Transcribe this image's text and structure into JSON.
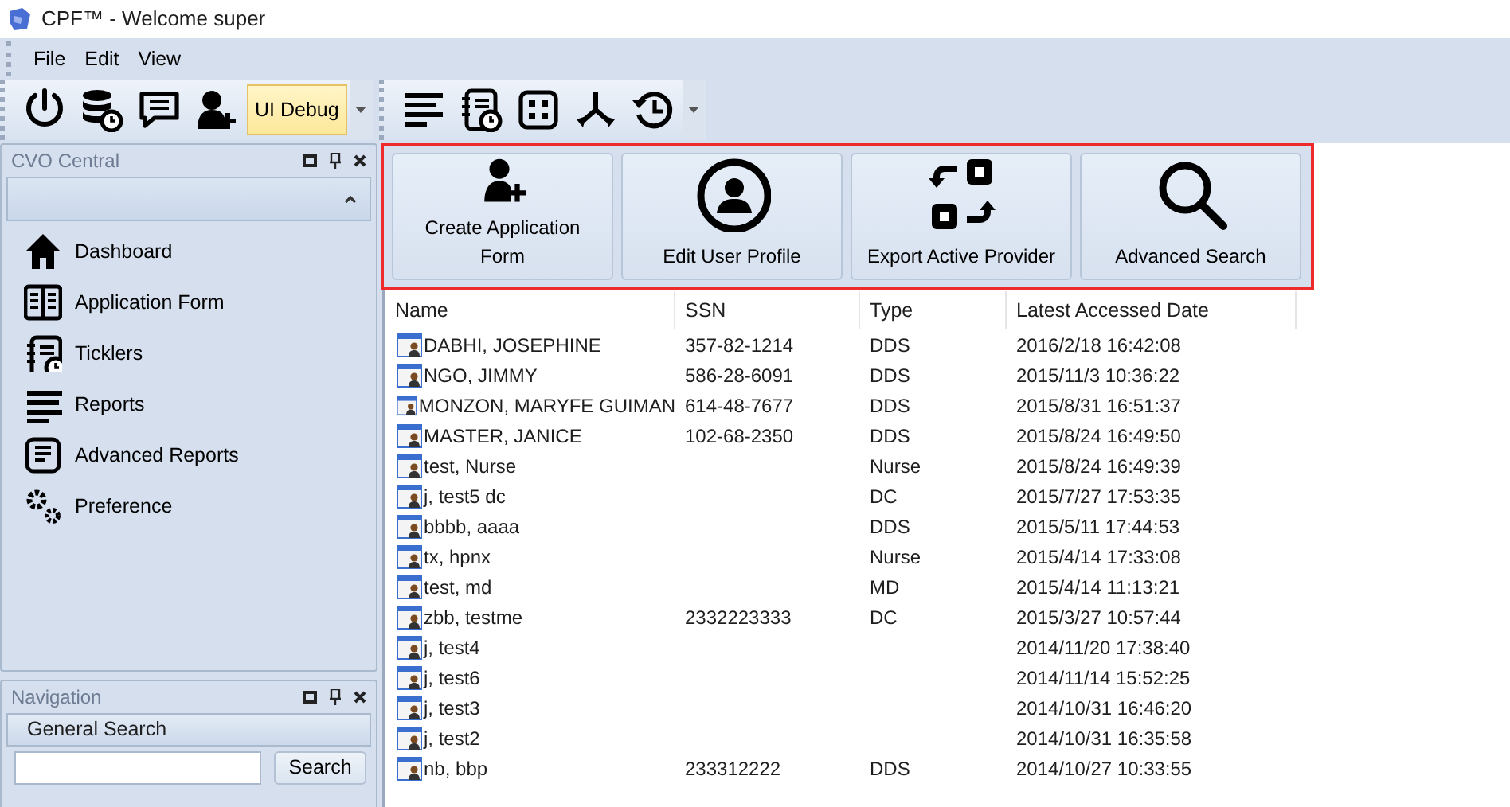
{
  "window": {
    "title": "CPF™  -  Welcome super"
  },
  "menu": [
    "File",
    "Edit",
    "View"
  ],
  "toolbar": {
    "toggle": {
      "label": "UI Debug",
      "on": true
    }
  },
  "cvo_panel": {
    "title": "CVO Central",
    "items": [
      {
        "label": "Dashboard"
      },
      {
        "label": "Application Form"
      },
      {
        "label": "Ticklers"
      },
      {
        "label": "Reports"
      },
      {
        "label": "Advanced Reports"
      },
      {
        "label": "Preference"
      }
    ]
  },
  "navigation_panel": {
    "title": "Navigation",
    "section": "General Search",
    "search_button": "Search"
  },
  "quick_actions": [
    {
      "label": "Create Application Form"
    },
    {
      "label": "Edit User Profile"
    },
    {
      "label": "Export Active Provider"
    },
    {
      "label": "Advanced Search"
    }
  ],
  "table": {
    "columns": [
      "Name",
      "SSN",
      "Type",
      "Latest Accessed Date"
    ],
    "rows": [
      [
        "DABHI, JOSEPHINE",
        "357-82-1214",
        "DDS",
        "2016/2/18 16:42:08"
      ],
      [
        "NGO, JIMMY",
        "586-28-6091",
        "DDS",
        "2015/11/3 10:36:22"
      ],
      [
        "MONZON, MARYFE GUIMAN",
        "614-48-7677",
        "DDS",
        "2015/8/31 16:51:37"
      ],
      [
        "MASTER, JANICE",
        "102-68-2350",
        "DDS",
        "2015/8/24 16:49:50"
      ],
      [
        "test, Nurse",
        "",
        "Nurse",
        "2015/8/24 16:49:39"
      ],
      [
        "j, test5 dc",
        "",
        "DC",
        "2015/7/27 17:53:35"
      ],
      [
        "bbbb, aaaa",
        "",
        "DDS",
        "2015/5/11 17:44:53"
      ],
      [
        "tx, hpnx",
        "",
        "Nurse",
        "2015/4/14 17:33:08"
      ],
      [
        "test, md",
        "",
        "MD",
        "2015/4/14 11:13:21"
      ],
      [
        "zbb, testme",
        "2332223333",
        "DC",
        "2015/3/27 10:57:44"
      ],
      [
        "j, test4",
        "",
        "",
        "2014/11/20 17:38:40"
      ],
      [
        "j, test6",
        "",
        "",
        "2014/11/14 15:52:25"
      ],
      [
        "j, test3",
        "",
        "",
        "2014/10/31 16:46:20"
      ],
      [
        "j, test2",
        "",
        "",
        "2014/10/31 16:35:58"
      ],
      [
        "nb, bbp",
        "233312222",
        "DDS",
        "2014/10/27 10:33:55"
      ]
    ]
  }
}
